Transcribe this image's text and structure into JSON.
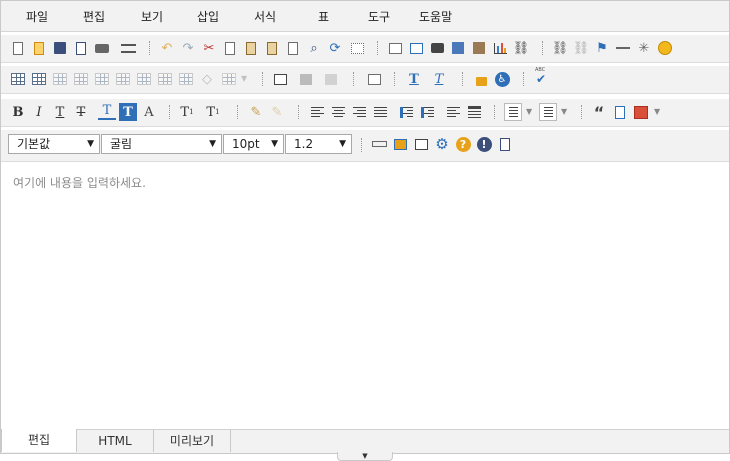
{
  "menu": [
    "파일",
    "편집",
    "보기",
    "삽입",
    "서식",
    "표",
    "도구",
    "도움말"
  ],
  "format_bar": {
    "paragraph_style": "기본값",
    "font_family": "굴림",
    "font_size": "10pt",
    "line_height": "1.2"
  },
  "toolbar_text": {
    "bold": "B",
    "italic": "I",
    "underline": "T",
    "strike": "T",
    "font_color": "T",
    "bg_color": "T",
    "clear_format": "A",
    "subscript": "T",
    "subscript_mark": "1",
    "superscript": "T",
    "superscript_mark": "1",
    "spell_check_small": "ABC",
    "quote": "“"
  },
  "editor": {
    "placeholder": "여기에 내용을 입력하세요."
  },
  "tabs": [
    "편집",
    "HTML",
    "미리보기"
  ],
  "resize_handle": "▼",
  "colors": {
    "toolbar_bg": "#f2f2f2",
    "border": "#c9c9c9",
    "placeholder": "#8c8c8c",
    "accent_blue": "#2f6fb7",
    "accent_orange": "#e8a21a"
  }
}
